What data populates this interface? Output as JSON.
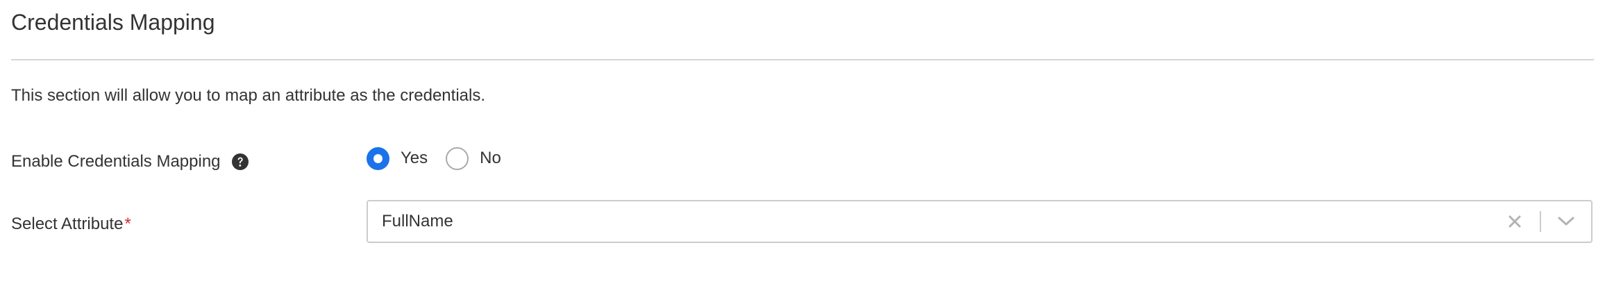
{
  "section": {
    "title": "Credentials Mapping",
    "description": "This section will allow you to map an attribute as the credentials."
  },
  "enable_mapping": {
    "label": "Enable Credentials Mapping",
    "help_icon": "question-circle-icon",
    "options": [
      {
        "label": "Yes",
        "checked": true
      },
      {
        "label": "No",
        "checked": false
      }
    ]
  },
  "select_attribute": {
    "label": "Select Attribute",
    "required_marker": "*",
    "value": "FullName",
    "clear_icon": "close-icon",
    "dropdown_icon": "chevron-down-icon"
  },
  "colors": {
    "accent": "#1a73e8",
    "required": "#d92929",
    "text": "#333333",
    "border": "#cccccc"
  }
}
